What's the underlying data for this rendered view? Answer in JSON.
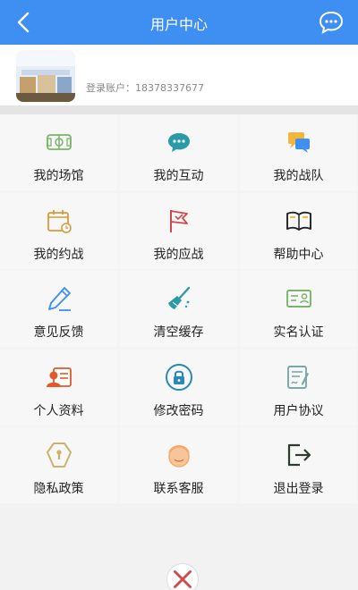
{
  "header": {
    "title": "用户中心"
  },
  "profile": {
    "account_label": "登录账户：18378337677"
  },
  "menu": [
    {
      "label": "我的场馆",
      "icon": "venue-icon"
    },
    {
      "label": "我的互动",
      "icon": "chat-icon"
    },
    {
      "label": "我的战队",
      "icon": "team-icon"
    },
    {
      "label": "我的约战",
      "icon": "calendar-icon"
    },
    {
      "label": "我的应战",
      "icon": "flag-icon"
    },
    {
      "label": "帮助中心",
      "icon": "book-icon"
    },
    {
      "label": "意见反馈",
      "icon": "pen-icon"
    },
    {
      "label": "清空缓存",
      "icon": "broom-icon"
    },
    {
      "label": "实名认证",
      "icon": "id-card-icon"
    },
    {
      "label": "个人资料",
      "icon": "profile-card-icon"
    },
    {
      "label": "修改密码",
      "icon": "lock-icon"
    },
    {
      "label": "用户协议",
      "icon": "document-sign-icon"
    },
    {
      "label": "隐私政策",
      "icon": "shield-icon"
    },
    {
      "label": "联系客服",
      "icon": "support-face-icon"
    },
    {
      "label": "退出登录",
      "icon": "logout-icon"
    }
  ],
  "colors": {
    "header_bg": "#3f8ef2",
    "accent": "#3f8ef2"
  }
}
